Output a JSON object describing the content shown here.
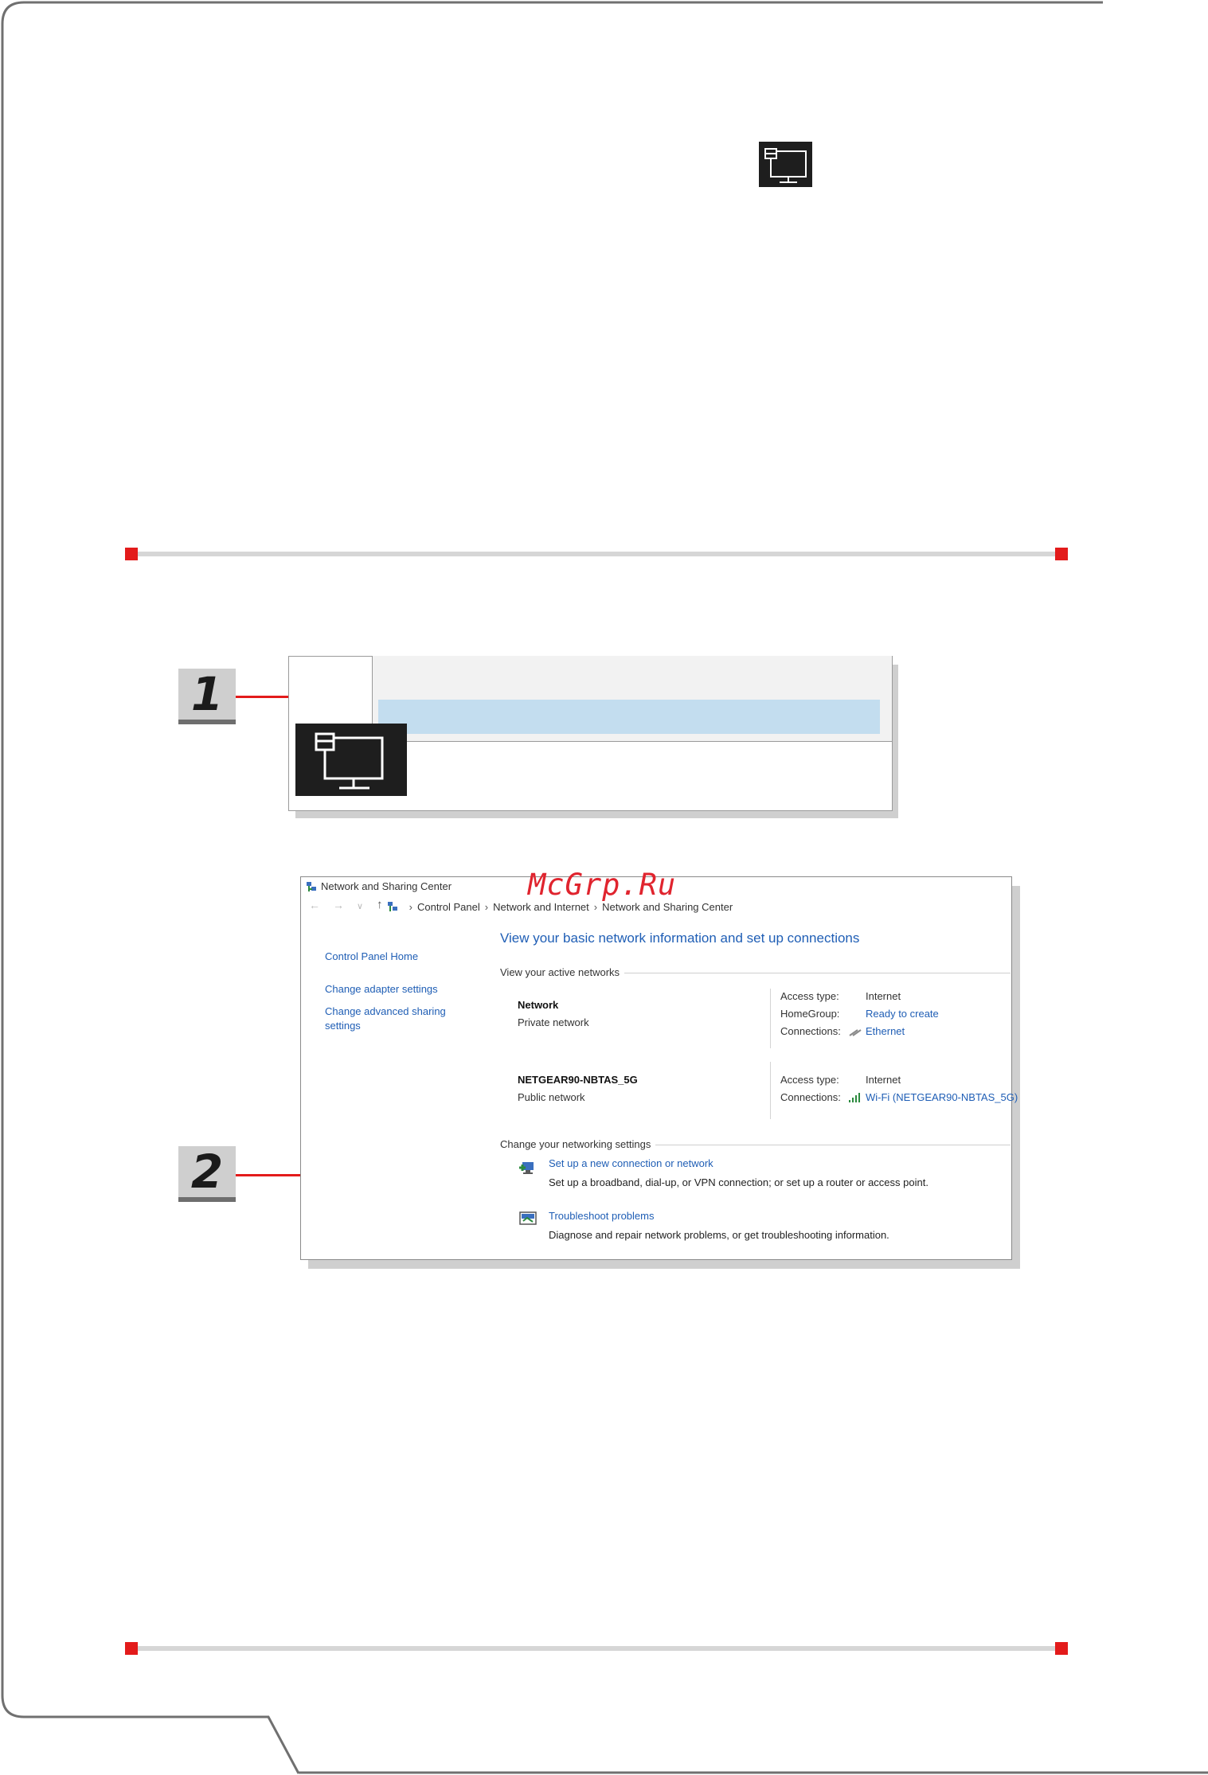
{
  "watermark": "McGrp.Ru",
  "steps": [
    "1",
    "2"
  ],
  "network_center": {
    "window_title": "Network and Sharing Center",
    "breadcrumb": [
      "Control Panel",
      "Network and Internet",
      "Network and Sharing Center"
    ],
    "left_nav": {
      "home": "Control Panel Home",
      "adapter": "Change adapter settings",
      "advanced_line1": "Change advanced sharing",
      "advanced_line2": "settings"
    },
    "main_title": "View your basic network information and set up connections",
    "active_networks_label": "View your active networks",
    "networks": [
      {
        "name": "Network",
        "type": "Private network",
        "access_type_label": "Access type:",
        "access_type": "Internet",
        "homegroup_label": "HomeGroup:",
        "homegroup": "Ready to create",
        "connections_label": "Connections:",
        "connection": "Ethernet"
      },
      {
        "name": "NETGEAR90-NBTAS_5G",
        "type": "Public network",
        "access_type_label": "Access type:",
        "access_type": "Internet",
        "connections_label": "Connections:",
        "connection": "Wi-Fi (NETGEAR90-NBTAS_5G)"
      }
    ],
    "change_settings_label": "Change your networking settings",
    "tasks": [
      {
        "link": "Set up a new connection or network",
        "description": "Set up a broadband, dial-up, or VPN connection; or set up a router or access point."
      },
      {
        "link": "Troubleshoot problems",
        "description": "Diagnose and repair network problems, or get troubleshooting information."
      }
    ]
  },
  "colors": {
    "accent_red": "#e31b1b",
    "link_blue": "#1f5eb5",
    "highlight_blue": "#c3ddef",
    "icon_dark": "#1e1e1e"
  }
}
